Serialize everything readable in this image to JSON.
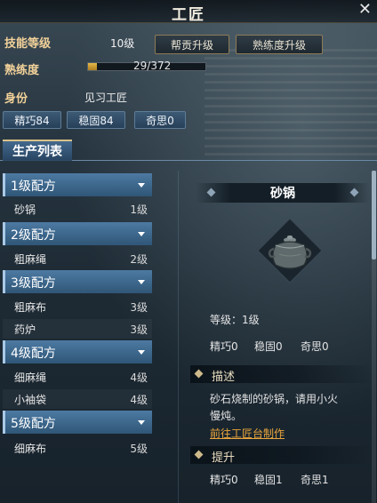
{
  "window": {
    "title": "工匠",
    "close_icon": "close-icon"
  },
  "skill": {
    "level_label": "技能等级",
    "level_value": "10级",
    "btn_contribution": "帮贡升级",
    "btn_proficiency": "熟练度升级",
    "proficiency_label": "熟练度",
    "proficiency_value": "29/372",
    "proficiency_fraction": 0.078,
    "identity_label": "身份",
    "identity_value": "见习工匠",
    "stats": [
      "精巧84",
      "稳固84",
      "奇思0"
    ]
  },
  "tabs": {
    "production_list": "生产列表"
  },
  "recipes": [
    {
      "group": "1级配方",
      "items": [
        {
          "name": "砂锅",
          "level": "1级"
        }
      ]
    },
    {
      "group": "2级配方",
      "items": [
        {
          "name": "粗麻绳",
          "level": "2级"
        }
      ]
    },
    {
      "group": "3级配方",
      "items": [
        {
          "name": "粗麻布",
          "level": "3级"
        },
        {
          "name": "药炉",
          "level": "3级"
        }
      ]
    },
    {
      "group": "4级配方",
      "items": [
        {
          "name": "细麻绳",
          "level": "4级"
        },
        {
          "name": "小袖袋",
          "level": "4级"
        }
      ]
    },
    {
      "group": "5级配方",
      "items": [
        {
          "name": "细麻布",
          "level": "5级"
        }
      ]
    }
  ],
  "detail": {
    "name": "砂锅",
    "item_icon": "clay-pot-icon",
    "level": "等级：1级",
    "stats": {
      "a": "精巧0",
      "b": "稳固0",
      "c": "奇思0"
    },
    "desc_title": "描述",
    "desc_line1": "砂石烧制的砂锅，请用小火",
    "desc_line2": "慢炖。",
    "link": "前往工匠台制作",
    "improve_title": "提升",
    "improve_stats": {
      "a": "精巧0",
      "b": "稳固1",
      "c": "奇思1"
    }
  },
  "colors": {
    "accent_gold": "#f3d29a",
    "group_blue": "#4d7aa3",
    "link_orange": "#e9a53c"
  }
}
